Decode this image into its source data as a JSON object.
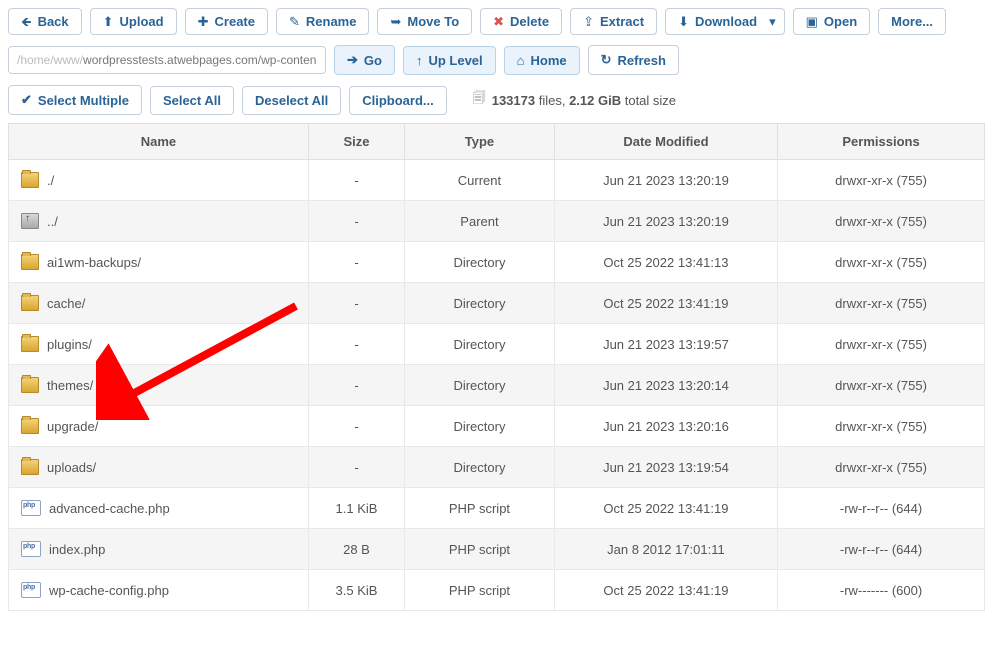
{
  "toolbar": {
    "back": "Back",
    "upload": "Upload",
    "create": "Create",
    "rename": "Rename",
    "move": "Move To",
    "delete": "Delete",
    "extract": "Extract",
    "download": "Download",
    "open": "Open",
    "more": "More..."
  },
  "path": {
    "prefix": "/home/www/",
    "value": "wordpresstests.atwebpages.com/wp-conten"
  },
  "nav": {
    "go": "Go",
    "uplevel": "Up Level",
    "home": "Home",
    "refresh": "Refresh"
  },
  "select": {
    "multi": "Select Multiple",
    "all": "Select All",
    "none": "Deselect All",
    "clip": "Clipboard..."
  },
  "stats": {
    "files_count": "133173",
    "files_word": " files, ",
    "size": "2.12 GiB",
    "suffix": " total size"
  },
  "headers": {
    "name": "Name",
    "size": "Size",
    "type": "Type",
    "date": "Date Modified",
    "perm": "Permissions"
  },
  "rows": [
    {
      "icon": "folder",
      "name": "./",
      "size": "-",
      "type": "Current",
      "date": "Jun 21 2023 13:20:19",
      "perm": "drwxr-xr-x (755)"
    },
    {
      "icon": "up",
      "name": "../",
      "size": "-",
      "type": "Parent",
      "date": "Jun 21 2023 13:20:19",
      "perm": "drwxr-xr-x (755)"
    },
    {
      "icon": "folder",
      "name": "ai1wm-backups/",
      "size": "-",
      "type": "Directory",
      "date": "Oct 25 2022 13:41:13",
      "perm": "drwxr-xr-x (755)"
    },
    {
      "icon": "folder",
      "name": "cache/",
      "size": "-",
      "type": "Directory",
      "date": "Oct 25 2022 13:41:19",
      "perm": "drwxr-xr-x (755)"
    },
    {
      "icon": "folder",
      "name": "plugins/",
      "size": "-",
      "type": "Directory",
      "date": "Jun 21 2023 13:19:57",
      "perm": "drwxr-xr-x (755)"
    },
    {
      "icon": "folder",
      "name": "themes/",
      "size": "-",
      "type": "Directory",
      "date": "Jun 21 2023 13:20:14",
      "perm": "drwxr-xr-x (755)"
    },
    {
      "icon": "folder",
      "name": "upgrade/",
      "size": "-",
      "type": "Directory",
      "date": "Jun 21 2023 13:20:16",
      "perm": "drwxr-xr-x (755)"
    },
    {
      "icon": "folder",
      "name": "uploads/",
      "size": "-",
      "type": "Directory",
      "date": "Jun 21 2023 13:19:54",
      "perm": "drwxr-xr-x (755)"
    },
    {
      "icon": "php",
      "name": "advanced-cache.php",
      "size": "1.1 KiB",
      "type": "PHP script",
      "date": "Oct 25 2022 13:41:19",
      "perm": "-rw-r--r-- (644)"
    },
    {
      "icon": "php",
      "name": "index.php",
      "size": "28 B",
      "type": "PHP script",
      "date": "Jan 8 2012 17:01:11",
      "perm": "-rw-r--r-- (644)"
    },
    {
      "icon": "php",
      "name": "wp-cache-config.php",
      "size": "3.5 KiB",
      "type": "PHP script",
      "date": "Oct 25 2022 13:41:19",
      "perm": "-rw------- (600)"
    }
  ]
}
